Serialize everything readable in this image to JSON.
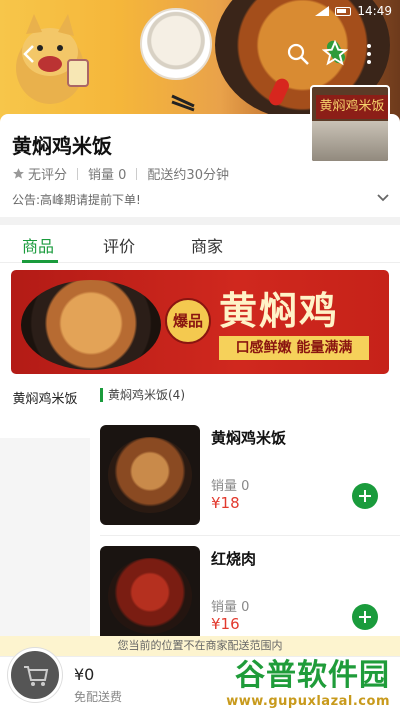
{
  "status_bar": {
    "time": "14:49"
  },
  "store": {
    "name": "黄焖鸡米饭",
    "thumb_sign": "黄焖鸡米饭",
    "rating": "无评分",
    "sales": "销量 0",
    "delivery_time": "配送约30分钟",
    "notice": "公告:高峰期请提前下单!"
  },
  "tabs": [
    {
      "label": "商品",
      "active": true
    },
    {
      "label": "评价",
      "active": false
    },
    {
      "label": "商家",
      "active": false
    }
  ],
  "promo": {
    "badge": "爆品",
    "title": "黄焖鸡",
    "slogan": "口感鲜嫩 能量满满"
  },
  "categories": [
    {
      "label": "黄焖鸡米饭"
    }
  ],
  "section_header": "黄焖鸡米饭(4)",
  "items": [
    {
      "name": "黄焖鸡米饭",
      "sales": "销量 0",
      "price": "¥18"
    },
    {
      "name": "红烧肉",
      "sales": "销量 0",
      "price": "¥16"
    }
  ],
  "location_notice": "您当前的位置不在商家配送范围内",
  "cart": {
    "total": "¥0",
    "delivery_fee": "免配送费"
  },
  "watermark": {
    "main": "谷普软件园",
    "url": "www.gupuxlazal.com"
  },
  "colors": {
    "accent": "#1a9b3c",
    "price": "#e23a2e",
    "promo_bg": "#c62219"
  }
}
